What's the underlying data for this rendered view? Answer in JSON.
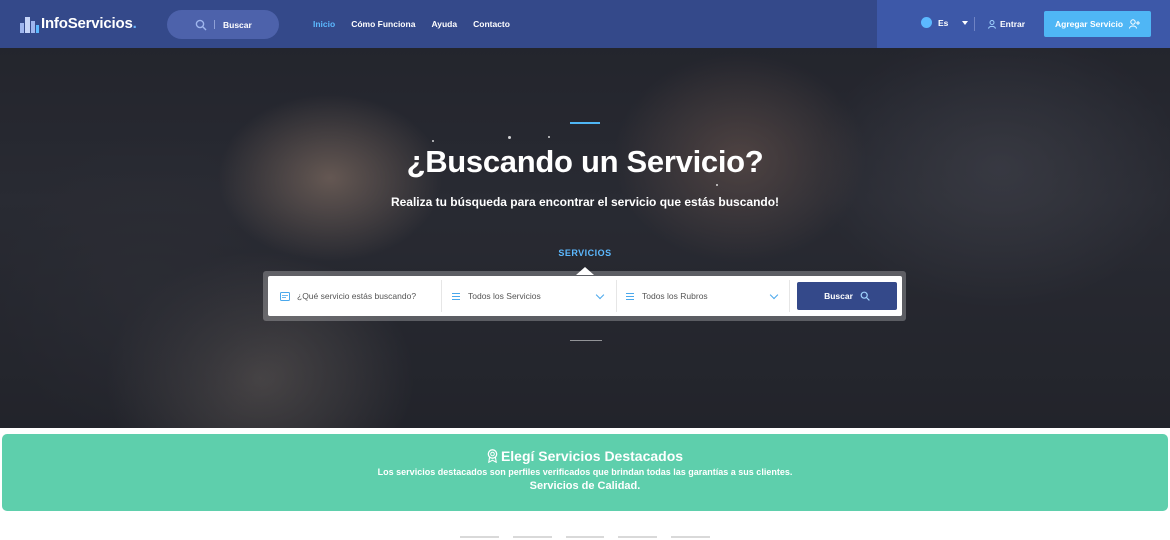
{
  "header": {
    "logo_text": "InfoServicios",
    "logo_dot": ".",
    "search_label": "Buscar",
    "nav": [
      {
        "label": "Inicio",
        "active": true
      },
      {
        "label": "Cómo Funciona",
        "active": false
      },
      {
        "label": "Ayuda",
        "active": false
      },
      {
        "label": "Contacto",
        "active": false
      }
    ],
    "language": "Es",
    "login_label": "Entrar",
    "add_service_label": "Agregar Servicio"
  },
  "hero": {
    "title": "¿Buscando un Servicio?",
    "subtitle": "Realiza tu búsqueda para encontrar el servicio que estás buscando!",
    "tab_label": "SERVICIOS",
    "search_placeholder": "¿Qué servicio estás buscando?",
    "services_select": "Todos los Servicios",
    "categories_select": "Todos los Rubros",
    "search_button": "Buscar"
  },
  "featured": {
    "title": "Elegí Servicios Destacados",
    "line1": "Los servicios destacados son perfiles verificados que brindan todas las garantías a sus clientes.",
    "line2": "Servicios de Calidad."
  },
  "colors": {
    "header_bg": "#34498a",
    "accent_blue": "#4fb6f5",
    "nav_active": "#5cb9ff",
    "featured_bg": "#5ecfac"
  }
}
